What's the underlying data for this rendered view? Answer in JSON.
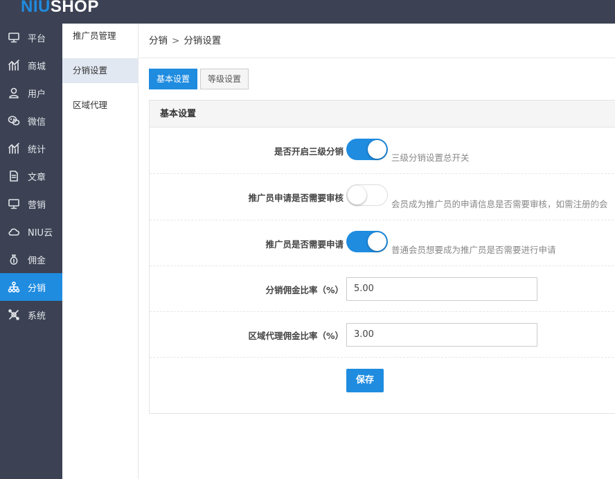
{
  "brand": {
    "logo_accent": "NIU",
    "logo_rest": "SHOP"
  },
  "sidebar": {
    "items": [
      {
        "label": "平台",
        "icon": "monitor-icon"
      },
      {
        "label": "商城",
        "icon": "chart-icon"
      },
      {
        "label": "用户",
        "icon": "user-icon"
      },
      {
        "label": "微信",
        "icon": "wechat-icon"
      },
      {
        "label": "统计",
        "icon": "stats-icon"
      },
      {
        "label": "文章",
        "icon": "document-icon"
      },
      {
        "label": "营销",
        "icon": "display-icon"
      },
      {
        "label": "NIU云",
        "icon": "cloud-icon"
      },
      {
        "label": "佣金",
        "icon": "money-bag-icon"
      },
      {
        "label": "分销",
        "icon": "distribution-icon"
      },
      {
        "label": "系统",
        "icon": "settings-icon"
      }
    ],
    "active_index": 9
  },
  "subnav": {
    "items": [
      "推广员管理",
      "分销设置",
      "区域代理"
    ],
    "active_index": 1
  },
  "breadcrumb": {
    "parent": "分销",
    "separator": ">",
    "current": "分销设置"
  },
  "tabs": [
    "基本设置",
    "等级设置"
  ],
  "panel": {
    "title": "基本设置",
    "settings": [
      {
        "label": "是否开启三级分销",
        "enabled": true,
        "hint": "三级分销设置总开关"
      },
      {
        "label": "推广员申请是否需要审核",
        "enabled": false,
        "hint": "会员成为推广员的申请信息是否需要审核，如需注册的会"
      },
      {
        "label": "推广员是否需要申请",
        "enabled": true,
        "hint": "普通会员想要成为推广员是否需要进行申请"
      }
    ],
    "rates": [
      {
        "label": "分销佣金比率（%）",
        "value": "5.00"
      },
      {
        "label": "区域代理佣金比率（%）",
        "value": "3.00"
      }
    ],
    "save_label": "保存"
  },
  "colors": {
    "accent": "#1f8ce0",
    "sidebar_bg": "#3c4254"
  }
}
